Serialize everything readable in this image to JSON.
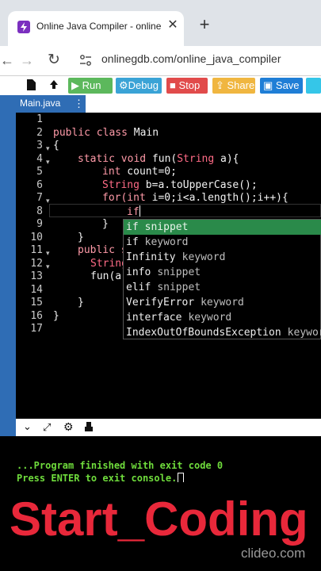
{
  "browser": {
    "tab_title": "Online Java Compiler - online c",
    "url": "onlinegdb.com/online_java_compiler",
    "colors": {
      "favicon": "#7b2fbf"
    }
  },
  "toolbar": {
    "run_label": "Run",
    "debug_label": "Debug",
    "stop_label": "Stop",
    "share_label": "Share",
    "save_label": "Save",
    "colors": {
      "run": "#5cb85c",
      "debug": "#3aa3d6",
      "stop": "#e14b4b",
      "share": "#f0b640",
      "save": "#1f7ed6"
    }
  },
  "editor": {
    "file_tab": "Main.java",
    "file_tab_menu": "⋮",
    "line_numbers": [
      "1",
      "2",
      "3",
      "4",
      "5",
      "6",
      "7",
      "8",
      "9",
      "10",
      "11",
      "12",
      "13",
      "14",
      "15",
      "16",
      "17"
    ],
    "lines": {
      "l2_kw": "public class",
      "l2_rest": " Main",
      "l3": "{",
      "l4_kw": "static void",
      "l4_fn": " fun(",
      "l4_ty": "String",
      "l4_rest": " a){",
      "l5_kw": "int",
      "l5_rest": " count=0;",
      "l6_ty": "String",
      "l6_rest": " b=a.toUpperCase();",
      "l7_kw": "for(int",
      "l7_rest": " i=0;i<a.length();i++){",
      "l8": "if",
      "l9": "}",
      "l10": "}",
      "l11": "public s",
      "l12": "String",
      "l13": "fun(a)",
      "l15": "}",
      "l16": "}"
    }
  },
  "autocomplete": {
    "items": [
      {
        "label": "if",
        "kind": "snippet"
      },
      {
        "label": "if",
        "kind": "keyword"
      },
      {
        "label": "Infinity",
        "kind": "keyword"
      },
      {
        "label": "info",
        "kind": "snippet"
      },
      {
        "label": "elif",
        "kind": "snippet"
      },
      {
        "label": "VerifyError",
        "kind": "keyword"
      },
      {
        "label": "interface",
        "kind": "keyword"
      },
      {
        "label": "IndexOutOfBoundsException",
        "kind": "keyword"
      }
    ]
  },
  "console": {
    "line1": "...Program finished with exit code 0",
    "line2": "Press ENTER to exit console.",
    "colors": {
      "text": "#6fdc3c"
    }
  },
  "overlay": {
    "title": "Start_Coding",
    "watermark": "clideo.com"
  }
}
